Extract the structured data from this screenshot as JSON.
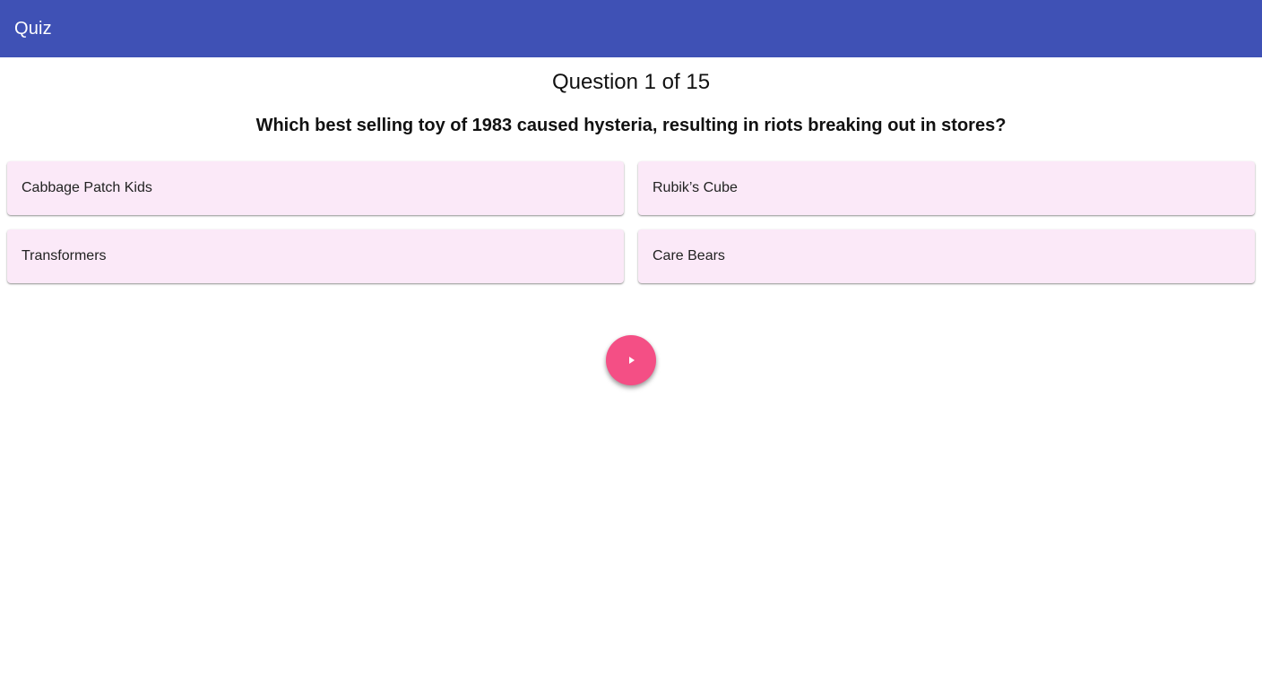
{
  "app_bar": {
    "title": "Quiz",
    "color": "#3f51b5"
  },
  "quiz": {
    "progress": "Question 1 of 15",
    "question": "Which best selling toy of 1983 caused hysteria, resulting in riots breaking out in stores?",
    "answers": [
      {
        "label": "Cabbage Patch Kids"
      },
      {
        "label": "Rubik’s Cube"
      },
      {
        "label": "Transformers"
      },
      {
        "label": "Care Bears"
      }
    ],
    "answer_color": "#fbe9f8"
  },
  "next_button": {
    "icon": "play-arrow-icon",
    "color": "#f44f85"
  }
}
